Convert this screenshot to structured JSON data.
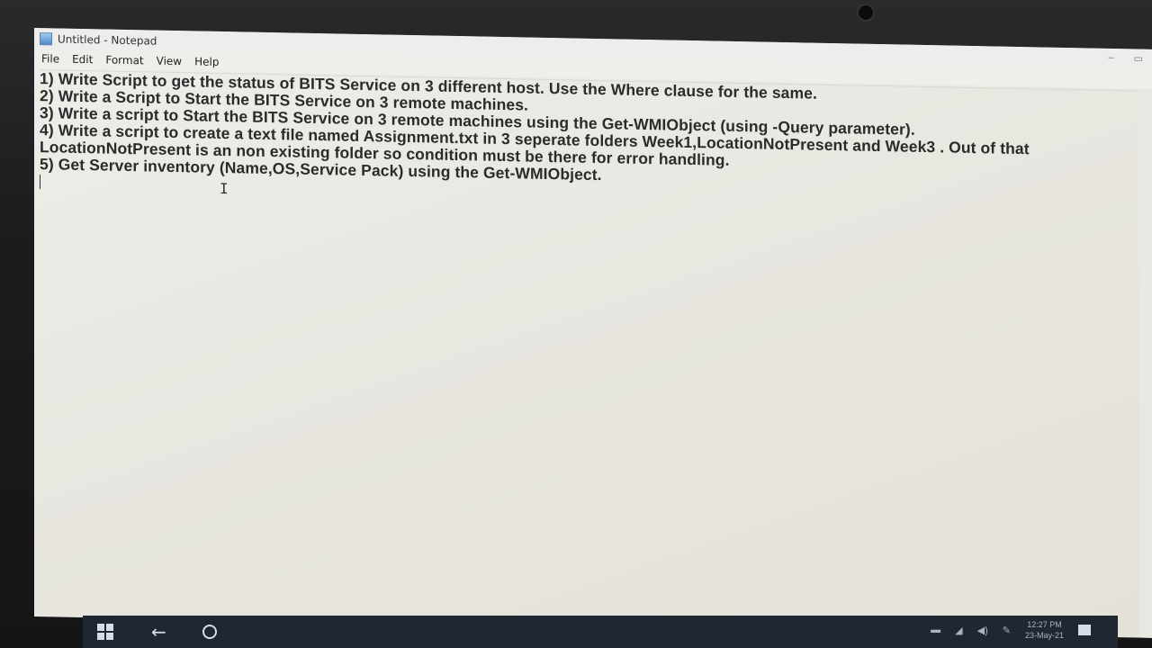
{
  "window": {
    "title": "Untitled - Notepad"
  },
  "menu": [
    "File",
    "Edit",
    "Format",
    "View",
    "Help"
  ],
  "document": {
    "lines": [
      "1) Write Script to get the status of BITS Service on 3 different host. Use the Where clause for the same.",
      "2) Write a Script to Start the BITS Service on 3 remote machines.",
      "3) Write a script to Start the BITS Service on 3 remote machines using the Get-WMIObject  (using -Query parameter).",
      "4) Write a script to create a text file named Assignment.txt in 3 seperate folders Week1,LocationNotPresent and Week3 . Out of that",
      "LocationNotPresent is an non existing folder so condition must be there for error handling.",
      "5) Get Server inventory (Name,OS,Service Pack) using the Get-WMIObject."
    ]
  },
  "taskbar": {
    "back_glyph": "←",
    "clock_time": "12:27 PM",
    "clock_date": "23-May-21"
  }
}
